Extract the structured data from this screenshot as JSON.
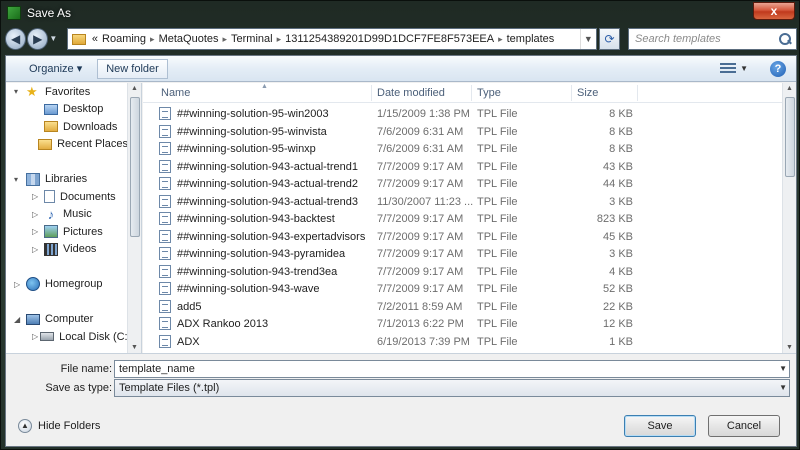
{
  "window": {
    "title": "Save As",
    "close_glyph": "x"
  },
  "address": {
    "back_glyph": "◀",
    "forward_glyph": "▶",
    "overflow": "«",
    "crumbs": [
      "Roaming",
      "MetaQuotes",
      "Terminal",
      "1311254389201D99D1DCF7FE8F573EEA",
      "templates"
    ],
    "search_placeholder": "Search templates"
  },
  "toolbar": {
    "organize_label": "Organize ▾",
    "new_folder_label": "New folder",
    "help_glyph": "?"
  },
  "navpane": {
    "items": [
      {
        "label": "Favorites",
        "level": 0,
        "icon": "star-icon",
        "expander": "▾"
      },
      {
        "label": "Desktop",
        "level": 1,
        "icon": "blue-folder-icon"
      },
      {
        "label": "Downloads",
        "level": 1,
        "icon": "folder-icon"
      },
      {
        "label": "Recent Places",
        "level": 1,
        "icon": "folder-icon"
      },
      {
        "label": "",
        "level": -1
      },
      {
        "label": "Libraries",
        "level": 0,
        "icon": "library-icon",
        "expander": "▾"
      },
      {
        "label": "Documents",
        "level": 1,
        "icon": "document-icon",
        "expander": "▷"
      },
      {
        "label": "Music",
        "level": 1,
        "icon": "music-icon",
        "expander": "▷"
      },
      {
        "label": "Pictures",
        "level": 1,
        "icon": "pictures-icon",
        "expander": "▷"
      },
      {
        "label": "Videos",
        "level": 1,
        "icon": "videos-icon",
        "expander": "▷"
      },
      {
        "label": "",
        "level": -1
      },
      {
        "label": "Homegroup",
        "level": 0,
        "icon": "homegroup-icon",
        "expander": "▷"
      },
      {
        "label": "",
        "level": -1
      },
      {
        "label": "Computer",
        "level": 0,
        "icon": "computer-icon",
        "expander": "◢"
      },
      {
        "label": "Local Disk (C:)",
        "level": 1,
        "icon": "disk-icon",
        "expander": "▷"
      }
    ]
  },
  "filelist": {
    "columns": {
      "name": "Name",
      "date": "Date modified",
      "type": "Type",
      "size": "Size"
    },
    "rows": [
      {
        "name": "##winning-solution-95-win2003",
        "date": "1/15/2009 1:38 PM",
        "type": "TPL File",
        "size": "8 KB"
      },
      {
        "name": "##winning-solution-95-winvista",
        "date": "7/6/2009 6:31 AM",
        "type": "TPL File",
        "size": "8 KB"
      },
      {
        "name": "##winning-solution-95-winxp",
        "date": "7/6/2009 6:31 AM",
        "type": "TPL File",
        "size": "8 KB"
      },
      {
        "name": "##winning-solution-943-actual-trend1",
        "date": "7/7/2009 9:17 AM",
        "type": "TPL File",
        "size": "43 KB"
      },
      {
        "name": "##winning-solution-943-actual-trend2",
        "date": "7/7/2009 9:17 AM",
        "type": "TPL File",
        "size": "44 KB"
      },
      {
        "name": "##winning-solution-943-actual-trend3",
        "date": "11/30/2007 11:23 ...",
        "type": "TPL File",
        "size": "3 KB"
      },
      {
        "name": "##winning-solution-943-backtest",
        "date": "7/7/2009 9:17 AM",
        "type": "TPL File",
        "size": "823 KB"
      },
      {
        "name": "##winning-solution-943-expertadvisors",
        "date": "7/7/2009 9:17 AM",
        "type": "TPL File",
        "size": "45 KB"
      },
      {
        "name": "##winning-solution-943-pyramidea",
        "date": "7/7/2009 9:17 AM",
        "type": "TPL File",
        "size": "3 KB"
      },
      {
        "name": "##winning-solution-943-trend3ea",
        "date": "7/7/2009 9:17 AM",
        "type": "TPL File",
        "size": "4 KB"
      },
      {
        "name": "##winning-solution-943-wave",
        "date": "7/7/2009 9:17 AM",
        "type": "TPL File",
        "size": "52 KB"
      },
      {
        "name": "add5",
        "date": "7/2/2011 8:59 AM",
        "type": "TPL File",
        "size": "22 KB"
      },
      {
        "name": "ADX Rankoo 2013",
        "date": "7/1/2013 6:22 PM",
        "type": "TPL File",
        "size": "12 KB"
      },
      {
        "name": "ADX",
        "date": "6/19/2013 7:39 PM",
        "type": "TPL File",
        "size": "1 KB"
      }
    ]
  },
  "form": {
    "filename_label": "File name:",
    "filename_value": "template_name",
    "savetype_label": "Save as type:",
    "savetype_value": "Template Files (*.tpl)"
  },
  "footer": {
    "hide_folders_label": "Hide Folders",
    "save_label": "Save",
    "cancel_label": "Cancel"
  }
}
